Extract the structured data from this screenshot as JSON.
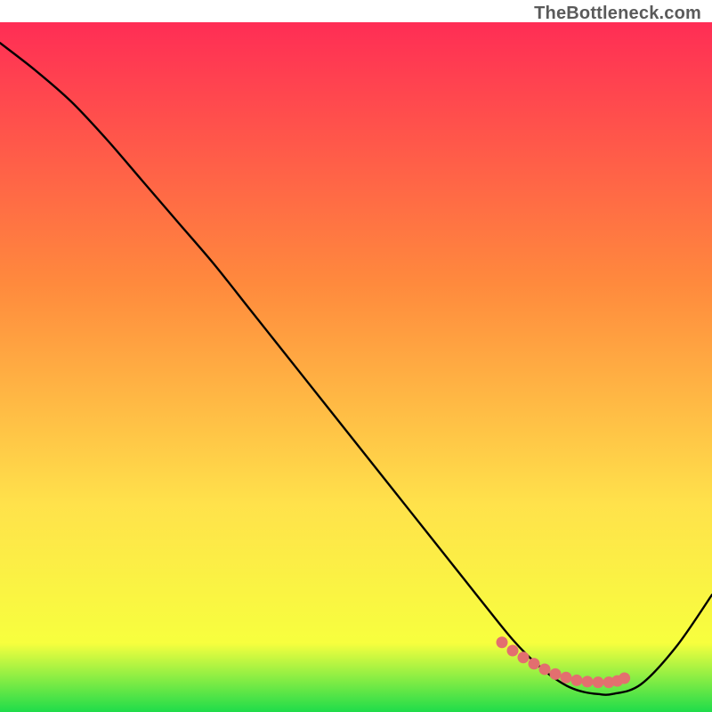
{
  "watermark": "TheBottleneck.com",
  "chart_data": {
    "type": "line",
    "title": "",
    "xlabel": "",
    "ylabel": "",
    "x_range": [
      0,
      100
    ],
    "y_range": [
      0,
      100
    ],
    "grid": false,
    "legend": false,
    "series": [
      {
        "name": "bottleneck-curve",
        "color": "#000000",
        "x": [
          0,
          5,
          10,
          15,
          20,
          25,
          30,
          35,
          40,
          45,
          50,
          55,
          60,
          65,
          70,
          72,
          74,
          76,
          78,
          80,
          82,
          84,
          86,
          90,
          95,
          100
        ],
        "y": [
          97,
          93,
          88.5,
          83,
          77,
          71,
          65,
          58.5,
          52,
          45.5,
          39,
          32.5,
          26,
          19.5,
          13,
          10.5,
          8.3,
          6.4,
          4.8,
          3.6,
          2.9,
          2.6,
          2.6,
          4,
          9.5,
          17
        ]
      }
    ],
    "markers": [
      {
        "name": "recommended-range",
        "color": "#e36f6f",
        "x": [
          70.5,
          72,
          73.5,
          75,
          76.5,
          78,
          79.5,
          81,
          82.5,
          84,
          85.5,
          86.7,
          87.7
        ],
        "y": [
          10.1,
          8.9,
          7.9,
          7.0,
          6.2,
          5.5,
          5.0,
          4.6,
          4.4,
          4.3,
          4.3,
          4.5,
          4.9
        ]
      }
    ],
    "gradient": {
      "top": "#ff2d55",
      "mid1": "#ff8a3d",
      "mid2": "#ffe24b",
      "mid3": "#f7ff3e",
      "bottom": "#1fdc4a"
    }
  }
}
